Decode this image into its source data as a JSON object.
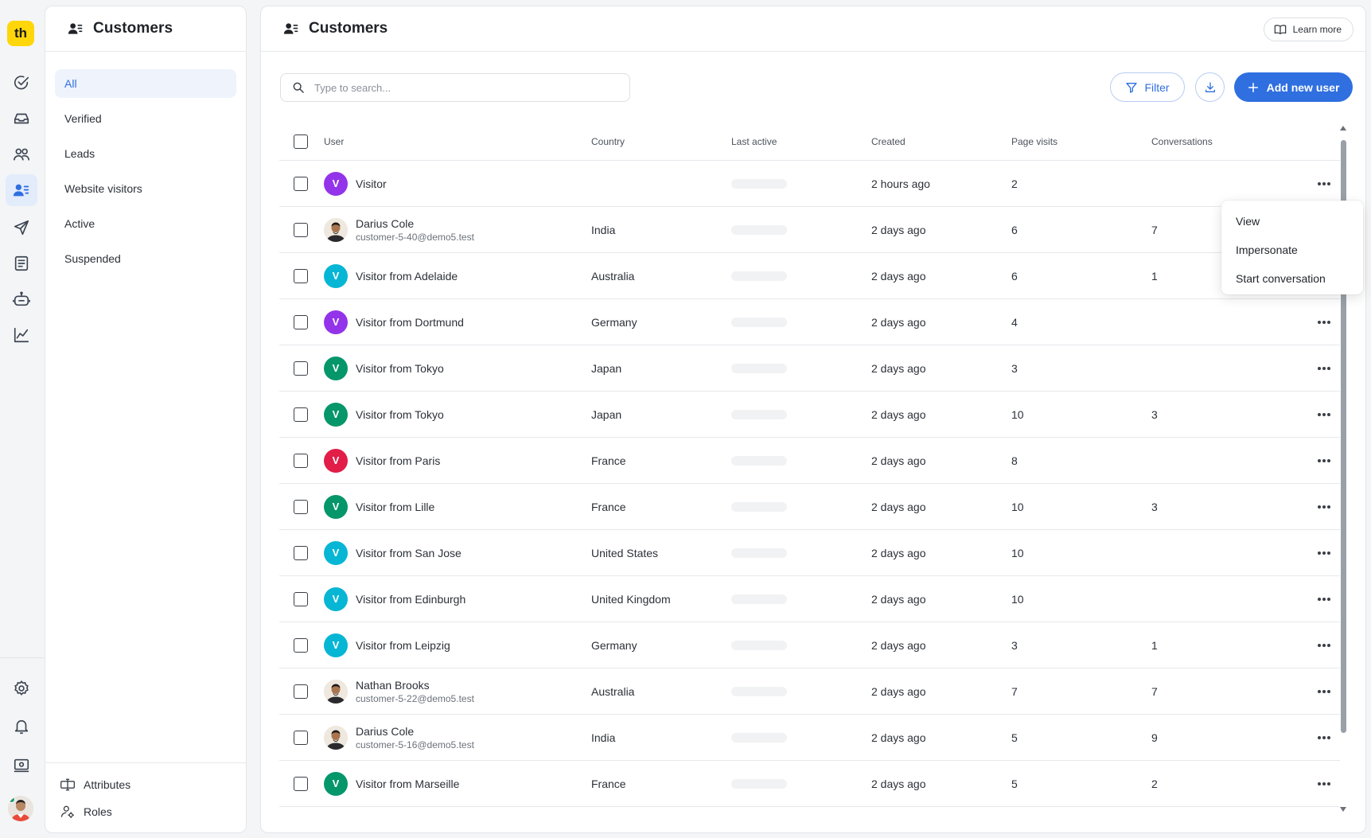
{
  "app": {
    "logo_text": "th"
  },
  "sidebar": {
    "title": "Customers",
    "items": [
      {
        "label": "All",
        "active": true
      },
      {
        "label": "Verified"
      },
      {
        "label": "Leads"
      },
      {
        "label": "Website visitors"
      },
      {
        "label": "Active"
      },
      {
        "label": "Suspended"
      }
    ],
    "footer": [
      {
        "label": "Attributes",
        "icon": "attributes-icon"
      },
      {
        "label": "Roles",
        "icon": "roles-icon"
      }
    ]
  },
  "main": {
    "title": "Customers",
    "learn_more": "Learn more",
    "search_placeholder": "Type to search...",
    "filter_label": "Filter",
    "add_user_label": "Add new user",
    "accent": "#2f6fe0"
  },
  "table": {
    "columns": [
      "User",
      "Country",
      "Last active",
      "Created",
      "Page visits",
      "Conversations"
    ],
    "rows": [
      {
        "name": "Visitor",
        "email": "",
        "avatar": "V",
        "avatar_color": "#9333ea",
        "country": "",
        "created": "2 hours ago",
        "visits": "2",
        "conversations": ""
      },
      {
        "name": "Darius Cole",
        "email": "customer-5-40@demo5.test",
        "avatar": "photo",
        "avatar_color": "",
        "country": "India",
        "created": "2 days ago",
        "visits": "6",
        "conversations": "7"
      },
      {
        "name": "Visitor from Adelaide",
        "email": "",
        "avatar": "V",
        "avatar_color": "#06b6d4",
        "country": "Australia",
        "created": "2 days ago",
        "visits": "6",
        "conversations": "1"
      },
      {
        "name": "Visitor from Dortmund",
        "email": "",
        "avatar": "V",
        "avatar_color": "#9333ea",
        "country": "Germany",
        "created": "2 days ago",
        "visits": "4",
        "conversations": ""
      },
      {
        "name": "Visitor from Tokyo",
        "email": "",
        "avatar": "V",
        "avatar_color": "#059669",
        "country": "Japan",
        "created": "2 days ago",
        "visits": "3",
        "conversations": ""
      },
      {
        "name": "Visitor from Tokyo",
        "email": "",
        "avatar": "V",
        "avatar_color": "#059669",
        "country": "Japan",
        "created": "2 days ago",
        "visits": "10",
        "conversations": "3"
      },
      {
        "name": "Visitor from Paris",
        "email": "",
        "avatar": "V",
        "avatar_color": "#e11d48",
        "country": "France",
        "created": "2 days ago",
        "visits": "8",
        "conversations": ""
      },
      {
        "name": "Visitor from Lille",
        "email": "",
        "avatar": "V",
        "avatar_color": "#059669",
        "country": "France",
        "created": "2 days ago",
        "visits": "10",
        "conversations": "3"
      },
      {
        "name": "Visitor from San Jose",
        "email": "",
        "avatar": "V",
        "avatar_color": "#06b6d4",
        "country": "United States",
        "created": "2 days ago",
        "visits": "10",
        "conversations": ""
      },
      {
        "name": "Visitor from Edinburgh",
        "email": "",
        "avatar": "V",
        "avatar_color": "#06b6d4",
        "country": "United Kingdom",
        "created": "2 days ago",
        "visits": "10",
        "conversations": ""
      },
      {
        "name": "Visitor from Leipzig",
        "email": "",
        "avatar": "V",
        "avatar_color": "#06b6d4",
        "country": "Germany",
        "created": "2 days ago",
        "visits": "3",
        "conversations": "1"
      },
      {
        "name": "Nathan Brooks",
        "email": "customer-5-22@demo5.test",
        "avatar": "photo",
        "avatar_color": "",
        "country": "Australia",
        "created": "2 days ago",
        "visits": "7",
        "conversations": "7"
      },
      {
        "name": "Darius Cole",
        "email": "customer-5-16@demo5.test",
        "avatar": "photo",
        "avatar_color": "",
        "country": "India",
        "created": "2 days ago",
        "visits": "5",
        "conversations": "9"
      },
      {
        "name": "Visitor from Marseille",
        "email": "",
        "avatar": "V",
        "avatar_color": "#059669",
        "country": "France",
        "created": "2 days ago",
        "visits": "5",
        "conversations": "2"
      }
    ]
  },
  "context_menu": {
    "items": [
      "View",
      "Impersonate",
      "Start conversation"
    ]
  }
}
